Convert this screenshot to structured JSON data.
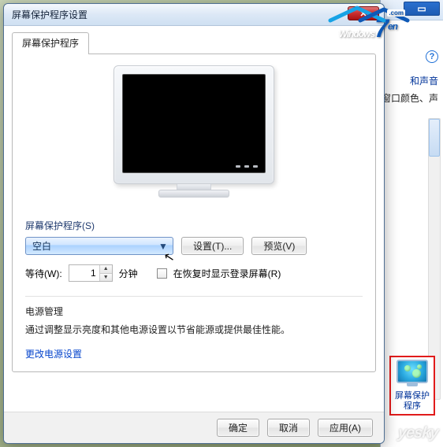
{
  "dialog": {
    "title": "屏幕保护程序设置",
    "tab_label": "屏幕保护程序",
    "group_label": "屏幕保护程序(S)",
    "dropdown_value": "空白",
    "settings_btn": "设置(T)...",
    "preview_btn": "预览(V)",
    "wait_label": "等待(W):",
    "wait_value": "1",
    "wait_unit": "分钟",
    "resume_checkbox": "在恢复时显示登录屏幕(R)",
    "power_section": "电源管理",
    "power_desc": "通过调整显示亮度和其他电源设置以节省能源或提供最佳性能。",
    "power_link": "更改电源设置",
    "ok": "确定",
    "cancel": "取消",
    "apply": "应用(A)"
  },
  "bg": {
    "text1": "和声音",
    "text2": "窗口颜色、声"
  },
  "side_icon_label": "屏幕保护程序",
  "watermark": "yesky",
  "logo": {
    "text": "Windows",
    "seven": "7",
    "en": "en",
    "com": ".com"
  }
}
